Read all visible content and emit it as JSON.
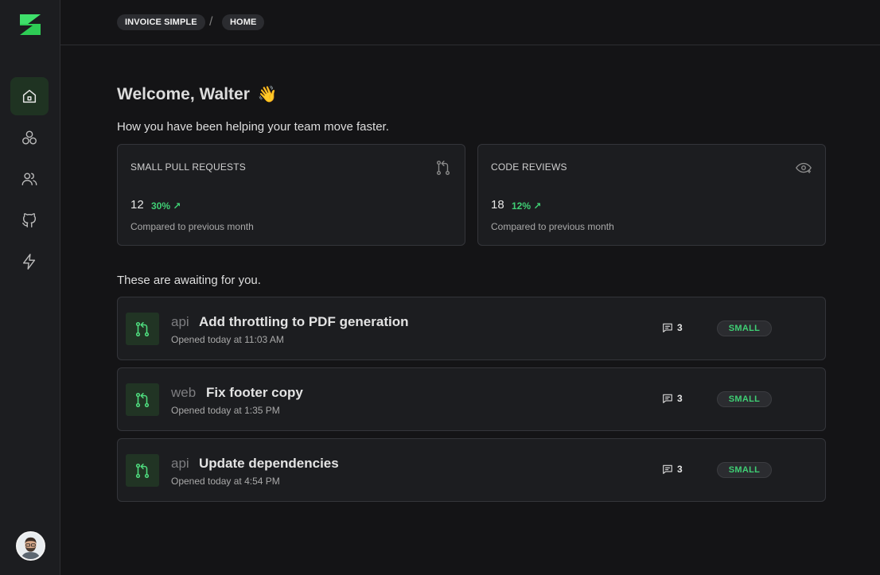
{
  "colors": {
    "accent": "#3fcf74",
    "background": "#141416",
    "sidebar": "#1c1d20",
    "card": "#1c1d20"
  },
  "sidebar": {
    "items": [
      {
        "icon": "home-icon",
        "active": true
      },
      {
        "icon": "circles-icon",
        "active": false
      },
      {
        "icon": "users-icon",
        "active": false
      },
      {
        "icon": "github-icon",
        "active": false
      },
      {
        "icon": "lightning-icon",
        "active": false
      }
    ]
  },
  "breadcrumb": {
    "items": [
      "INVOICE SIMPLE",
      "HOME"
    ],
    "separator": "/"
  },
  "welcome": {
    "title": "Welcome, Walter",
    "emoji": "👋",
    "subtitle": "How you have been helping your team move faster."
  },
  "stats": [
    {
      "title": "SMALL PULL REQUESTS",
      "value": "12",
      "change": "30% ↗",
      "caption": "Compared to previous month",
      "icon": "pull-request-icon"
    },
    {
      "title": "CODE REVIEWS",
      "value": "18",
      "change": "12% ↗",
      "caption": "Compared to previous month",
      "icon": "eye-icon"
    }
  ],
  "awaiting": {
    "title": "These are awaiting for you.",
    "items": [
      {
        "repo": "api",
        "title": "Add throttling to PDF generation",
        "opened": "Opened today at 11:03 AM",
        "comments": "3",
        "size": "SMALL"
      },
      {
        "repo": "web",
        "title": "Fix footer copy",
        "opened": "Opened today at 1:35 PM",
        "comments": "3",
        "size": "SMALL"
      },
      {
        "repo": "api",
        "title": "Update dependencies",
        "opened": "Opened today at 4:54 PM",
        "comments": "3",
        "size": "SMALL"
      }
    ]
  }
}
